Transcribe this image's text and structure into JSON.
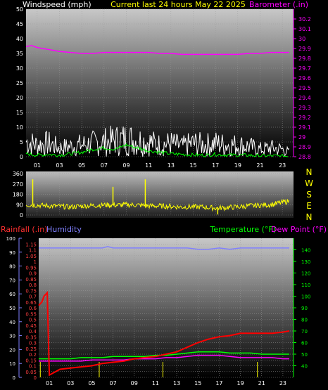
{
  "header": {
    "wind_title": "Windspeed (mph)",
    "center_title": "Current last 24 hours May 22 2025",
    "baro_title": "Barometer (.in)"
  },
  "bottom_header": {
    "rain_title": "Rainfall (.in)",
    "humidity_title": "Humidity",
    "temp_title": "Temperature (°F)",
    "dewpoint_title": "Dew Point (°F)"
  },
  "direction_labels": [
    "N",
    "W",
    "S",
    "E",
    "N"
  ],
  "colors": {
    "wind": "#ffffff",
    "gust": "#ffffff",
    "avgwind": "#00ff00",
    "barometer": "#ff00ff",
    "direction": "#ffff00",
    "rainfall": "#ff0000",
    "humidity": "#8080ff",
    "temperature": "#00ff00",
    "dewpoint": "#ff00ff",
    "rain_axis": "#ff4040",
    "hum_axis": "#8080ff",
    "temp_axis": "#00ff00",
    "title_yellow": "#ffff00"
  },
  "chart_data": [
    {
      "id": "wind_baro",
      "type": "line",
      "title": "Current last 24 hours May 22 2025",
      "xlabel": "",
      "x_ticks": [
        "01",
        "03",
        "05",
        "07",
        "09",
        "11",
        "13",
        "15",
        "17",
        "19",
        "21",
        "23"
      ],
      "x_range": [
        0,
        24
      ],
      "ylabel_left": "Windspeed (mph)",
      "ylim_left": [
        0,
        50
      ],
      "yticks_left": [
        0,
        5,
        10,
        15,
        20,
        25,
        30,
        35,
        40,
        45,
        50
      ],
      "ylabel_right": "Barometer (.in)",
      "ylim_right": [
        28.8,
        30.3
      ],
      "yticks_right": [
        28.8,
        28.9,
        29,
        29.1,
        29.2,
        29.3,
        29.4,
        29.5,
        29.6,
        29.7,
        29.8,
        29.9,
        30,
        30.1,
        30.2
      ],
      "grid": true,
      "series": [
        {
          "name": "Barometer",
          "axis": "right",
          "x": [
            0,
            0.5,
            1,
            1.5,
            2,
            2.5,
            3,
            4,
            5,
            6,
            7,
            8,
            9,
            10,
            11,
            12,
            13,
            14,
            15,
            16,
            17,
            18,
            19,
            20,
            21,
            22,
            23,
            23.6
          ],
          "values": [
            29.92,
            29.93,
            29.91,
            29.9,
            29.89,
            29.88,
            29.87,
            29.86,
            29.85,
            29.85,
            29.86,
            29.86,
            29.86,
            29.86,
            29.86,
            29.85,
            29.85,
            29.84,
            29.84,
            29.84,
            29.84,
            29.84,
            29.84,
            29.85,
            29.85,
            29.86,
            29.86,
            29.86
          ]
        },
        {
          "name": "Gust",
          "axis": "left",
          "x": [
            0,
            1,
            2,
            3,
            4,
            5,
            6,
            7,
            8,
            9,
            10,
            11,
            12,
            13,
            14,
            15,
            16,
            17,
            18,
            19,
            20,
            21,
            22,
            23,
            23.6
          ],
          "values": [
            10,
            8,
            9,
            6,
            7,
            8,
            9,
            10,
            11,
            12,
            11,
            10,
            8,
            9,
            7,
            9,
            8,
            9,
            8,
            8,
            7,
            5,
            6,
            5,
            3
          ]
        },
        {
          "name": "Average",
          "axis": "left",
          "x": [
            0,
            1,
            2,
            3,
            4,
            5,
            6,
            7,
            8,
            9,
            10,
            11,
            12,
            13,
            14,
            15,
            16,
            17,
            18,
            19,
            20,
            21,
            22,
            23,
            23.6
          ],
          "values": [
            1,
            0.5,
            0.8,
            0.5,
            1,
            1.5,
            2.5,
            3,
            2.5,
            4,
            3,
            2,
            1.5,
            1,
            0.8,
            0.6,
            0.5,
            0.8,
            0.6,
            0.5,
            0.5,
            0.3,
            0.3,
            0.2,
            0.2
          ]
        }
      ]
    },
    {
      "id": "direction",
      "type": "line",
      "x_ticks": [],
      "x_range": [
        0,
        24
      ],
      "ylim": [
        0,
        360
      ],
      "yticks": [
        0,
        90,
        180,
        270,
        360
      ],
      "grid": true,
      "series": [
        {
          "name": "Wind Direction",
          "x": [
            0,
            1,
            2,
            3,
            4,
            5,
            6,
            7,
            8,
            9,
            10,
            11,
            12,
            13,
            14,
            15,
            16,
            17,
            18,
            19,
            20,
            21,
            22,
            23,
            23.6
          ],
          "values": [
            90,
            85,
            80,
            75,
            70,
            78,
            82,
            88,
            85,
            90,
            87,
            80,
            78,
            75,
            70,
            72,
            68,
            60,
            65,
            70,
            80,
            85,
            90,
            110,
            120
          ],
          "spikes": [
            {
              "x": 0.6,
              "value": 310
            },
            {
              "x": 7.8,
              "value": 245
            },
            {
              "x": 10.7,
              "value": 310
            },
            {
              "x": 17.2,
              "value": 5
            }
          ]
        }
      ]
    },
    {
      "id": "rain_temp",
      "type": "line",
      "x_ticks": [
        "01",
        "03",
        "05",
        "07",
        "09",
        "11",
        "13",
        "15",
        "17",
        "19",
        "21",
        "23"
      ],
      "x_range": [
        0,
        24
      ],
      "ylabel_left": "Rainfall (.in)",
      "ylim_left": [
        0,
        1.2
      ],
      "yticks_left": [
        0,
        0.05,
        0.1,
        0.15,
        0.2,
        0.25,
        0.3,
        0.35,
        0.4,
        0.45,
        0.5,
        0.55,
        0.6,
        0.65,
        0.7,
        0.75,
        0.8,
        0.85,
        0.9,
        0.95,
        1,
        1.05,
        1.1,
        1.15
      ],
      "ylabel_humidity": "Humidity",
      "ylim_humidity": [
        0,
        100
      ],
      "yticks_humidity": [
        0,
        10,
        20,
        30,
        40,
        50,
        60,
        70,
        80,
        90,
        100
      ],
      "ylabel_right": "Temperature (°F)",
      "ylim_right": [
        30,
        150
      ],
      "yticks_right": [
        40,
        50,
        60,
        70,
        80,
        90,
        100,
        110,
        120,
        130,
        140
      ],
      "grid": true,
      "series": [
        {
          "name": "Rainfall",
          "axis": "left",
          "x": [
            0,
            0.3,
            0.5,
            0.8,
            1,
            2,
            3,
            4,
            5,
            6,
            7,
            8,
            9,
            10,
            11,
            12,
            13,
            14,
            15,
            16,
            17,
            18,
            19,
            20,
            21,
            22,
            23,
            23.6
          ],
          "values": [
            0.62,
            0.65,
            0.7,
            0.73,
            0.02,
            0.07,
            0.08,
            0.09,
            0.1,
            0.12,
            0.13,
            0.14,
            0.16,
            0.17,
            0.18,
            0.2,
            0.22,
            0.26,
            0.3,
            0.33,
            0.35,
            0.36,
            0.38,
            0.38,
            0.38,
            0.38,
            0.39,
            0.4
          ]
        },
        {
          "name": "Humidity",
          "axis": "humidity",
          "x": [
            0,
            1,
            2,
            3,
            4,
            5,
            6,
            6.5,
            7,
            8,
            9,
            10,
            11,
            12,
            13,
            14,
            15,
            16,
            17,
            18,
            19,
            20,
            21,
            22,
            23,
            23.6
          ],
          "values": [
            93,
            93,
            93,
            93,
            93,
            93,
            93,
            94,
            93,
            93,
            93,
            93,
            93,
            93,
            93,
            93,
            92,
            92,
            93,
            92,
            93,
            93,
            93,
            93,
            93,
            93
          ]
        },
        {
          "name": "Temperature",
          "axis": "right",
          "x": [
            0,
            1,
            2,
            3,
            4,
            5,
            6,
            7,
            8,
            9,
            10,
            11,
            12,
            13,
            14,
            15,
            16,
            17,
            18,
            19,
            20,
            21,
            22,
            23,
            23.6
          ],
          "values": [
            46,
            46,
            46,
            46,
            47,
            47,
            47,
            48,
            48,
            48,
            48,
            49,
            49,
            50,
            51,
            52,
            52,
            52,
            51,
            51,
            51,
            50,
            50,
            50,
            50
          ]
        },
        {
          "name": "Dew Point",
          "axis": "right",
          "x": [
            0,
            1,
            2,
            3,
            4,
            5,
            6,
            7,
            8,
            9,
            10,
            11,
            12,
            13,
            14,
            15,
            16,
            17,
            18,
            19,
            20,
            21,
            22,
            23,
            23.6
          ],
          "values": [
            44,
            44,
            44,
            44,
            44,
            45,
            45,
            45,
            45,
            46,
            46,
            46,
            47,
            47,
            48,
            49,
            49,
            49,
            48,
            47,
            47,
            47,
            47,
            46,
            46
          ]
        }
      ],
      "rain_events": [
        {
          "x": 0.15
        },
        {
          "x": 5.7
        },
        {
          "x": 11.7
        },
        {
          "x": 20.6
        }
      ]
    }
  ]
}
